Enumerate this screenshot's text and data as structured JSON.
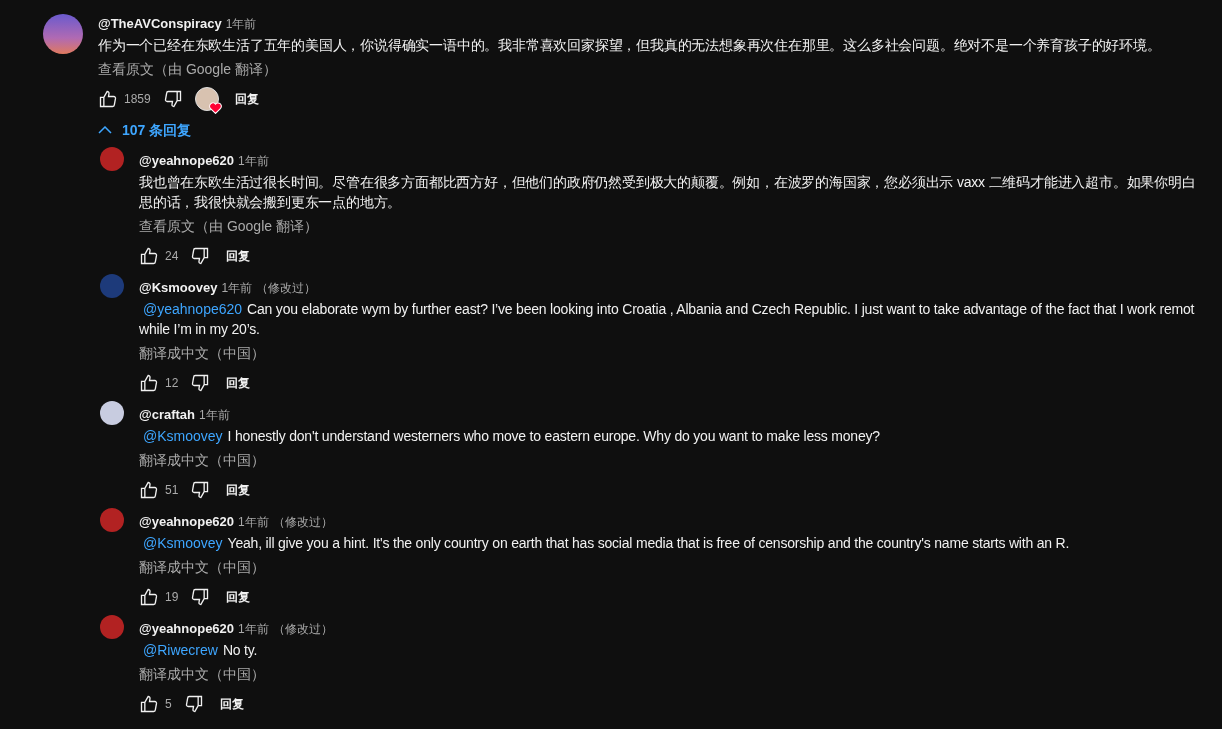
{
  "comment": {
    "author": "@TheAVConspiracy",
    "time": "1年前",
    "text_lines": [
      "作为一个已经在东欧生活了五年的美国人，你说得确实一语中的。我非常喜欢回家探望，但我真的无法想象再次住在那里。这么多社会问题。绝对不是一个养育孩子的好环境。"
    ],
    "translate_link": "查看原文（由 Google 翻译）",
    "likes": "1859",
    "creator_heart": true,
    "reply_button": "回复"
  },
  "replies_toggle": {
    "label": "107 条回复",
    "expanded": true
  },
  "replies": [
    {
      "author": "@yeahnope620",
      "time": "1年前",
      "color": "#b22222",
      "text_lines": [
        "我也曾在东欧生活过很长时间。尽管在很多方面都比西方好，但他们的政府仍然受到极大的颠覆。例如，在波罗的海国家，您必须出示 vaxx 二维码才能进入超市。如果你明白",
        "思的话，我很快就会搬到更东一点的地方。"
      ],
      "translate_link": "查看原文（由 Google 翻译）",
      "likes": "24",
      "reply_button": "回复"
    },
    {
      "author": "@Ksmoovey",
      "time": "1年前",
      "edited_label": "（修改过）",
      "color": "#1d3a7a",
      "mention": "@yeahnope620",
      "text_lines": [
        "Can you elaborate wym by further east? I’ve been looking into Croatia  , Albania and Czech Republic. I just want to take advantage of the fact that I work remot",
        "while I’m in my 20’s."
      ],
      "translate_link": "翻译成中文（中国）",
      "likes": "12",
      "reply_button": "回复"
    },
    {
      "author": "@craftah",
      "time": "1年前",
      "color": "#c8cce0",
      "mention": "@Ksmoovey",
      "text_lines": [
        "I honestly don't understand westerners who move to eastern europe. Why do you want to make less money?"
      ],
      "translate_link": "翻译成中文（中国）",
      "likes": "51",
      "reply_button": "回复"
    },
    {
      "author": "@yeahnope620",
      "time": "1年前",
      "edited_label": "（修改过）",
      "color": "#b22222",
      "mention": "@Ksmoovey",
      "text_lines": [
        "Yeah, ill give you a hint. It's the only country on earth that has social media that is free of censorship and the country's name starts with an R."
      ],
      "translate_link": "翻译成中文（中国）",
      "likes": "19",
      "reply_button": "回复"
    },
    {
      "author": "@yeahnope620",
      "time": "1年前",
      "edited_label": "（修改过）",
      "color": "#b22222",
      "mention": "@Riwecrew",
      "text_lines": [
        "No ty."
      ],
      "translate_link": "翻译成中文（中国）",
      "likes": "5",
      "reply_button": "回复"
    }
  ]
}
